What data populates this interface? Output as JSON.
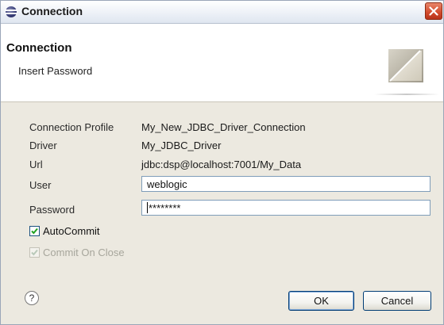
{
  "window": {
    "title": "Connection",
    "close_icon": "close-icon"
  },
  "banner": {
    "title": "Connection",
    "subtitle": "Insert Password",
    "graphic_icon": "connection-wizard-graphic"
  },
  "form": {
    "profile_label": "Connection Profile",
    "profile_value": "My_New_JDBC_Driver_Connection",
    "driver_label": "Driver",
    "driver_value": "My_JDBC_Driver",
    "url_label": "Url",
    "url_value": "jdbc:dsp@localhost:7001/My_Data",
    "user_label": "User",
    "user_value": "weblogic",
    "password_label": "Password",
    "password_value": "********",
    "autocommit_label": "AutoCommit",
    "autocommit_checked": true,
    "commit_on_close_label": "Commit On Close",
    "commit_on_close_checked": true,
    "commit_on_close_enabled": false
  },
  "footer": {
    "help_label": "?",
    "ok_label": "OK",
    "cancel_label": "Cancel"
  },
  "colors": {
    "title_bar": "#edf1f7",
    "close_button": "#d24a2b",
    "dialog_body": "#ece9e0",
    "input_border": "#7f9db9",
    "check_green": "#21a121"
  }
}
